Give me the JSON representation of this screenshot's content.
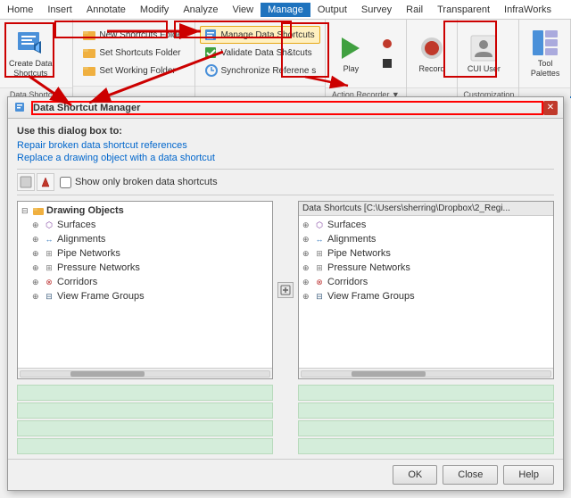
{
  "menubar": {
    "items": [
      "Home",
      "Insert",
      "Annotate",
      "Modify",
      "Analyze",
      "View",
      "Manage",
      "Output",
      "Survey",
      "Rail",
      "Transparent",
      "InfraWorks"
    ]
  },
  "ribbon": {
    "groups": [
      {
        "id": "create-data-shortcuts",
        "big_button": {
          "label": "Create Data\nShortcuts",
          "icon": "shortcut-icon"
        },
        "footer": "Data Shortcuts ▼"
      },
      {
        "id": "data-shortcuts-group",
        "small_buttons": [
          {
            "label": "New Shortcuts Folder",
            "icon": "folder-icon"
          },
          {
            "label": "Set Shortcuts Folder",
            "icon": "folder-icon"
          },
          {
            "label": "Set Working Folder",
            "icon": "folder-icon"
          }
        ],
        "footer": ""
      },
      {
        "id": "manage-data-shortcuts",
        "small_buttons": [
          {
            "label": "Manage Data Shortcuts",
            "icon": "manage-icon",
            "highlighted": true
          },
          {
            "label": "Validate Data Shortcuts",
            "icon": "validate-icon"
          },
          {
            "label": "Synchronize References",
            "icon": "sync-icon"
          }
        ],
        "footer": ""
      },
      {
        "id": "record-group",
        "big_button": {
          "label": "Record",
          "icon": "record-icon"
        },
        "footer": "Action Recorder ▼"
      },
      {
        "id": "cui-user",
        "big_button": {
          "label": "CUI User",
          "icon": "cui-icon"
        },
        "footer": "Customization"
      }
    ]
  },
  "dialog": {
    "title": "Data Shortcut Manager",
    "title_icon": "manager-icon",
    "instructions_heading": "Use this dialog box to:",
    "links": [
      "Repair broken data shortcut references",
      "Replace a drawing object with a data shortcut"
    ],
    "toolbar": {
      "show_only_broken_label": "Show only broken data shortcuts"
    },
    "left_panel": {
      "header": "",
      "tree_root": "Drawing Objects",
      "items": [
        {
          "label": "Surfaces",
          "indent": 1,
          "icon": "surface-icon"
        },
        {
          "label": "Alignments",
          "indent": 1,
          "icon": "alignment-icon"
        },
        {
          "label": "Pipe Networks",
          "indent": 1,
          "icon": "pipe-icon"
        },
        {
          "label": "Pressure Networks",
          "indent": 1,
          "icon": "pressure-icon"
        },
        {
          "label": "Corridors",
          "indent": 1,
          "icon": "corridor-icon"
        },
        {
          "label": "View Frame Groups",
          "indent": 1,
          "icon": "viewframe-icon"
        }
      ]
    },
    "right_panel": {
      "header": "Data Shortcuts [C:\\Users\\sherring\\Dropbox\\2_Regi...",
      "items": [
        {
          "label": "Surfaces",
          "indent": 1,
          "icon": "surface-icon"
        },
        {
          "label": "Alignments",
          "indent": 1,
          "icon": "alignment-icon"
        },
        {
          "label": "Pipe Networks",
          "indent": 1,
          "icon": "pipe-icon"
        },
        {
          "label": "Pressure Networks",
          "indent": 1,
          "icon": "pressure-icon"
        },
        {
          "label": "Corridors",
          "indent": 1,
          "icon": "corridor-icon"
        },
        {
          "label": "View Frame Groups",
          "indent": 1,
          "icon": "viewframe-icon"
        }
      ]
    },
    "green_rows_count": 4,
    "footer_buttons": [
      "OK",
      "Close",
      "Help"
    ]
  },
  "annotations": {
    "arrows": [
      {
        "from": "create-data-shortcuts-label",
        "to": "dialog-title"
      },
      {
        "from": "new-shortcuts-folder-label",
        "to": "manage-data-shortcuts-btn"
      },
      {
        "from": "record-label",
        "to": "action-recorder-footer"
      }
    ]
  }
}
